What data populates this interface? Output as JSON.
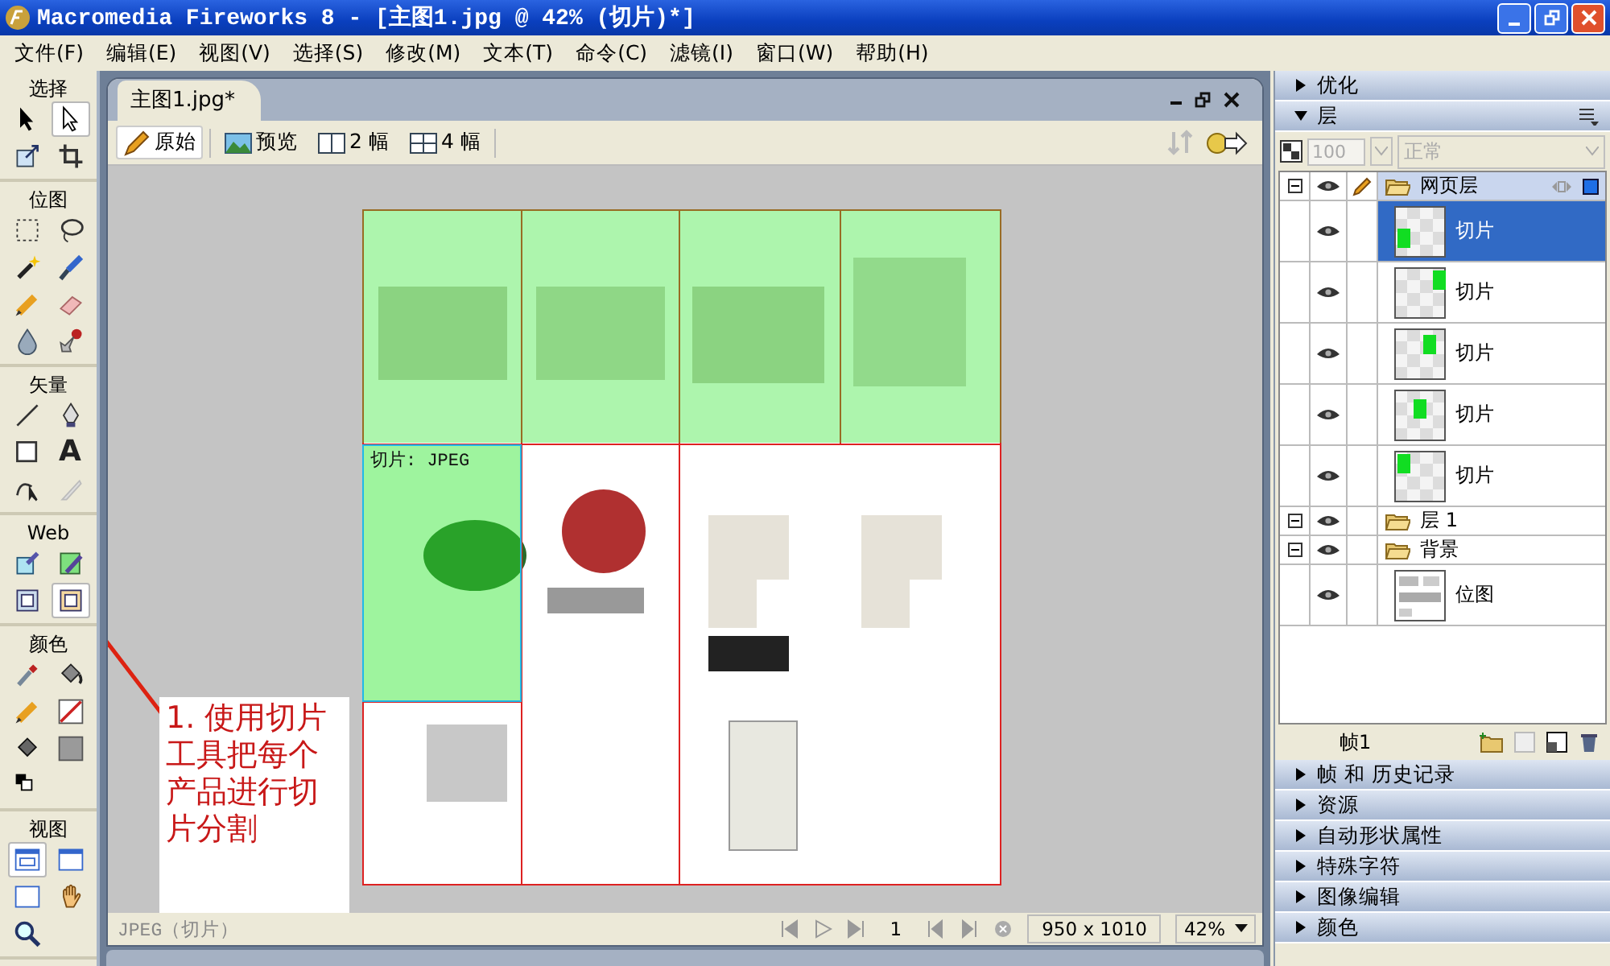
{
  "window": {
    "title": "Macromedia Fireworks 8 - [主图1.jpg @  42% (切片)*]"
  },
  "menu": [
    "文件(F)",
    "编辑(E)",
    "视图(V)",
    "选择(S)",
    "修改(M)",
    "文本(T)",
    "命令(C)",
    "滤镜(I)",
    "窗口(W)",
    "帮助(H)"
  ],
  "tools": {
    "sections": [
      {
        "title": "选择",
        "tools": [
          {
            "selected": false
          },
          {
            "selected": true
          },
          {
            "selected": false
          },
          {
            "selected": false
          }
        ]
      },
      {
        "title": "位图",
        "tools": [
          {
            "selected": false
          },
          {
            "selected": false
          },
          {
            "selected": false
          },
          {
            "selected": false
          },
          {
            "selected": false
          },
          {
            "selected": false
          },
          {
            "selected": false
          },
          {
            "selected": false
          }
        ]
      },
      {
        "title": "矢量",
        "tools": [
          {
            "selected": false
          },
          {
            "selected": false
          },
          {
            "selected": false
          },
          {
            "selected": false,
            "glyph": "A"
          },
          {
            "selected": false
          },
          {
            "selected": false
          }
        ]
      },
      {
        "title": "Web",
        "tools": [
          {
            "selected": false
          },
          {
            "selected": false
          },
          {
            "selected": false
          },
          {
            "selected": true
          }
        ]
      },
      {
        "title": "颜色",
        "tools": [
          {
            "selected": false
          },
          {
            "selected": false
          },
          {
            "selected": false
          },
          {
            "selected": false
          },
          {
            "selected": false
          },
          {
            "selected": false
          },
          {
            "selected": false
          }
        ]
      },
      {
        "title": "视图",
        "tools": [
          {
            "selected": true
          },
          {
            "selected": false
          },
          {
            "selected": false
          },
          {
            "selected": false
          },
          {
            "selected": false
          }
        ]
      }
    ]
  },
  "document": {
    "tab": "主图1.jpg*",
    "views": [
      {
        "label": "原始",
        "selected": true
      },
      {
        "label": "预览",
        "selected": false
      },
      {
        "label": "2 幅",
        "selected": false
      },
      {
        "label": "4 幅",
        "selected": false
      }
    ],
    "slices": [
      {
        "selected": false
      },
      {
        "selected": false
      },
      {
        "selected": false
      },
      {
        "selected": false
      },
      {
        "selected": true,
        "label": "切片: JPEG"
      }
    ],
    "status": "JPEG（切片）",
    "frame": "1",
    "size": "950 x 1010",
    "zoom": "42%"
  },
  "annotation": "1. 使用切片工具把每个产品进行切片分割",
  "panels": {
    "optimize": {
      "title": "优化",
      "expanded": false
    },
    "layers": {
      "title": "层",
      "expanded": true,
      "opacity": "100",
      "blend": "正常",
      "layers": [
        {
          "name": "网页层",
          "expanded": true,
          "children": [
            {
              "name": "切片",
              "selected": true
            },
            {
              "name": "切片",
              "selected": false
            },
            {
              "name": "切片",
              "selected": false
            },
            {
              "name": "切片",
              "selected": false
            },
            {
              "name": "切片",
              "selected": false
            }
          ]
        },
        {
          "name": "层 1",
          "expanded": true
        },
        {
          "name": "背景",
          "expanded": true,
          "children": [
            {
              "name": "位图",
              "selected": false
            }
          ]
        }
      ],
      "frame": "帧1"
    },
    "collapsed": [
      "帧 和 历史记录",
      "资源",
      "自动形状属性",
      "特殊字符",
      "图像编辑",
      "颜色"
    ]
  }
}
